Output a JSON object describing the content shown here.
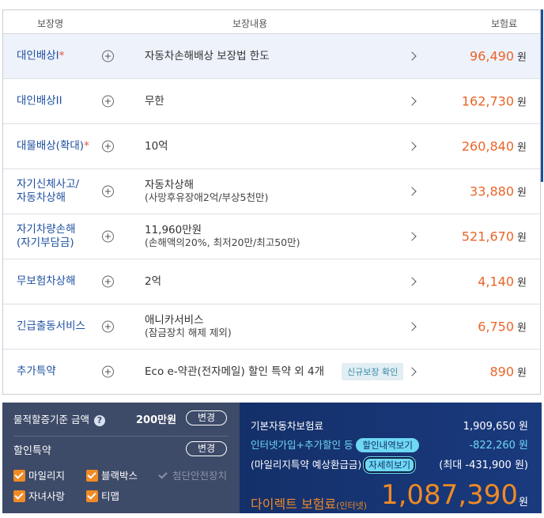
{
  "table": {
    "headers": {
      "name": "보장명",
      "content": "보장내용",
      "premium": "보험료"
    },
    "currency": "원",
    "rows": [
      {
        "name": "대인배상I",
        "required": "*",
        "content": "자동차손해배상 보장법 한도",
        "sub": "",
        "badge": "",
        "premium": "96,490"
      },
      {
        "name": "대인배상II",
        "required": "",
        "content": "무한",
        "sub": "",
        "badge": "",
        "premium": "162,730"
      },
      {
        "name": "대물배상(확대)",
        "required": "*",
        "content": "10억",
        "sub": "",
        "badge": "",
        "premium": "260,840"
      },
      {
        "name": "자기신체사고/",
        "name2": "자동차상해",
        "required": "",
        "content": "자동차상해",
        "sub": "(사망후유장애2억/부상5천만)",
        "badge": "",
        "premium": "33,880"
      },
      {
        "name": "자기차량손해",
        "name2": "(자기부담금)",
        "required": "",
        "content": "11,960만원",
        "sub": "(손해액의20%, 최저20만/최고50만)",
        "badge": "",
        "premium": "521,670"
      },
      {
        "name": "무보험차상해",
        "required": "",
        "content": "2억",
        "sub": "",
        "badge": "",
        "premium": "4,140"
      },
      {
        "name": "긴급출동서비스",
        "required": "",
        "content": "애니카서비스",
        "sub": "(잠금장치 해제 제외)",
        "badge": "",
        "premium": "6,750"
      },
      {
        "name": "추가특약",
        "required": "",
        "content": "Eco e-약관(전자메일) 할인 특약 외 4개",
        "sub": "",
        "badge": "신규보장 확인",
        "premium": "890"
      }
    ]
  },
  "left_panel": {
    "property_label": "물적할증기준 금액",
    "property_amount": "200만원",
    "change_label": "변경",
    "discount_label": "할인특약",
    "discount_change_label": "변경",
    "checkboxes": [
      {
        "label": "마일리지",
        "checked": true,
        "disabled": false
      },
      {
        "label": "블랙박스",
        "checked": true,
        "disabled": false
      },
      {
        "label": "첨단안전장치",
        "checked": true,
        "disabled": true
      },
      {
        "label": "자녀사랑",
        "checked": true,
        "disabled": false
      },
      {
        "label": "티맵",
        "checked": true,
        "disabled": false
      }
    ]
  },
  "right_panel": {
    "base_label": "기본자동차보험료",
    "base_value": "1,909,650 원",
    "discount_label": "인터넷가입+추가할인 등",
    "discount_btn": "할인내역보기",
    "discount_value": "-822,260 원",
    "refund_label": "(마일리지특약 예상환급금)",
    "refund_btn": "자세히보기",
    "refund_value": "(최대 -431,900 원)",
    "final_label": "다이렉트 보험료",
    "final_label_suffix": "(인터넷)",
    "final_amount": "1,087,390",
    "final_currency": "원"
  },
  "colors": {
    "accent_orange": "#e8652a",
    "link_blue": "#1d4fa0",
    "panel_left": "#3d4a68",
    "panel_right": "#14306a",
    "cyan": "#6fd8f3"
  }
}
